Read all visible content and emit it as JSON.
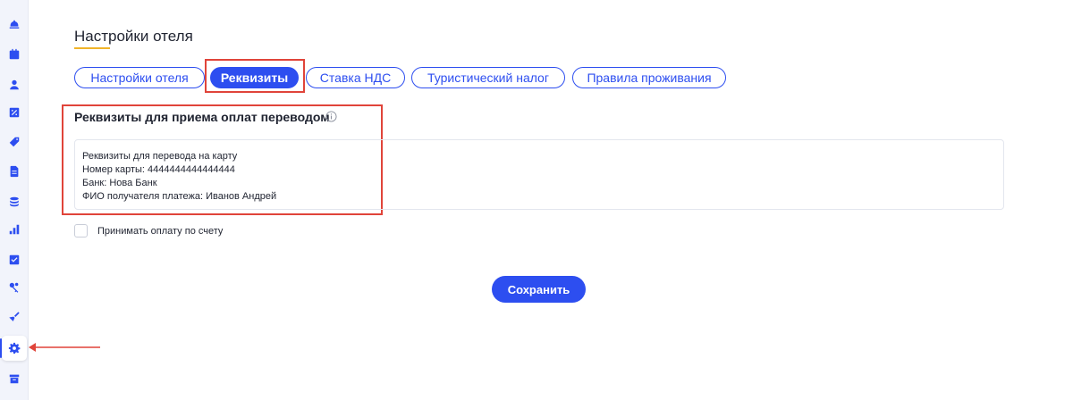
{
  "page": {
    "title": "Настройки отеля",
    "accent_color": "#2d4ef0",
    "annotation_color": "#e0443a"
  },
  "tabs": [
    {
      "label": "Настройки отеля",
      "active": false
    },
    {
      "label": "Реквизиты",
      "active": true
    },
    {
      "label": "Ставка НДС",
      "active": false
    },
    {
      "label": "Туристический налог",
      "active": false
    },
    {
      "label": "Правила проживания",
      "active": false
    }
  ],
  "section": {
    "title": "Реквизиты для приема оплат переводом",
    "info_icon": "info-icon",
    "details_value": "Реквизиты для перевода на карту\nНомер карты: 4444444444444444\nБанк: Нова Банк\nФИО получателя платежа: Иванов Андрей"
  },
  "checkbox": {
    "label": "Принимать оплату по счету",
    "checked": false
  },
  "actions": {
    "save_label": "Сохранить"
  },
  "sidebar": {
    "icons": [
      "bell-icon",
      "calendar-icon",
      "user-icon",
      "percent-icon",
      "tag-icon",
      "document-icon",
      "coins-icon",
      "chart-icon",
      "checklist-icon",
      "keys-icon",
      "broom-icon",
      "gear-icon",
      "box-icon"
    ],
    "active_icon": "gear-icon"
  }
}
